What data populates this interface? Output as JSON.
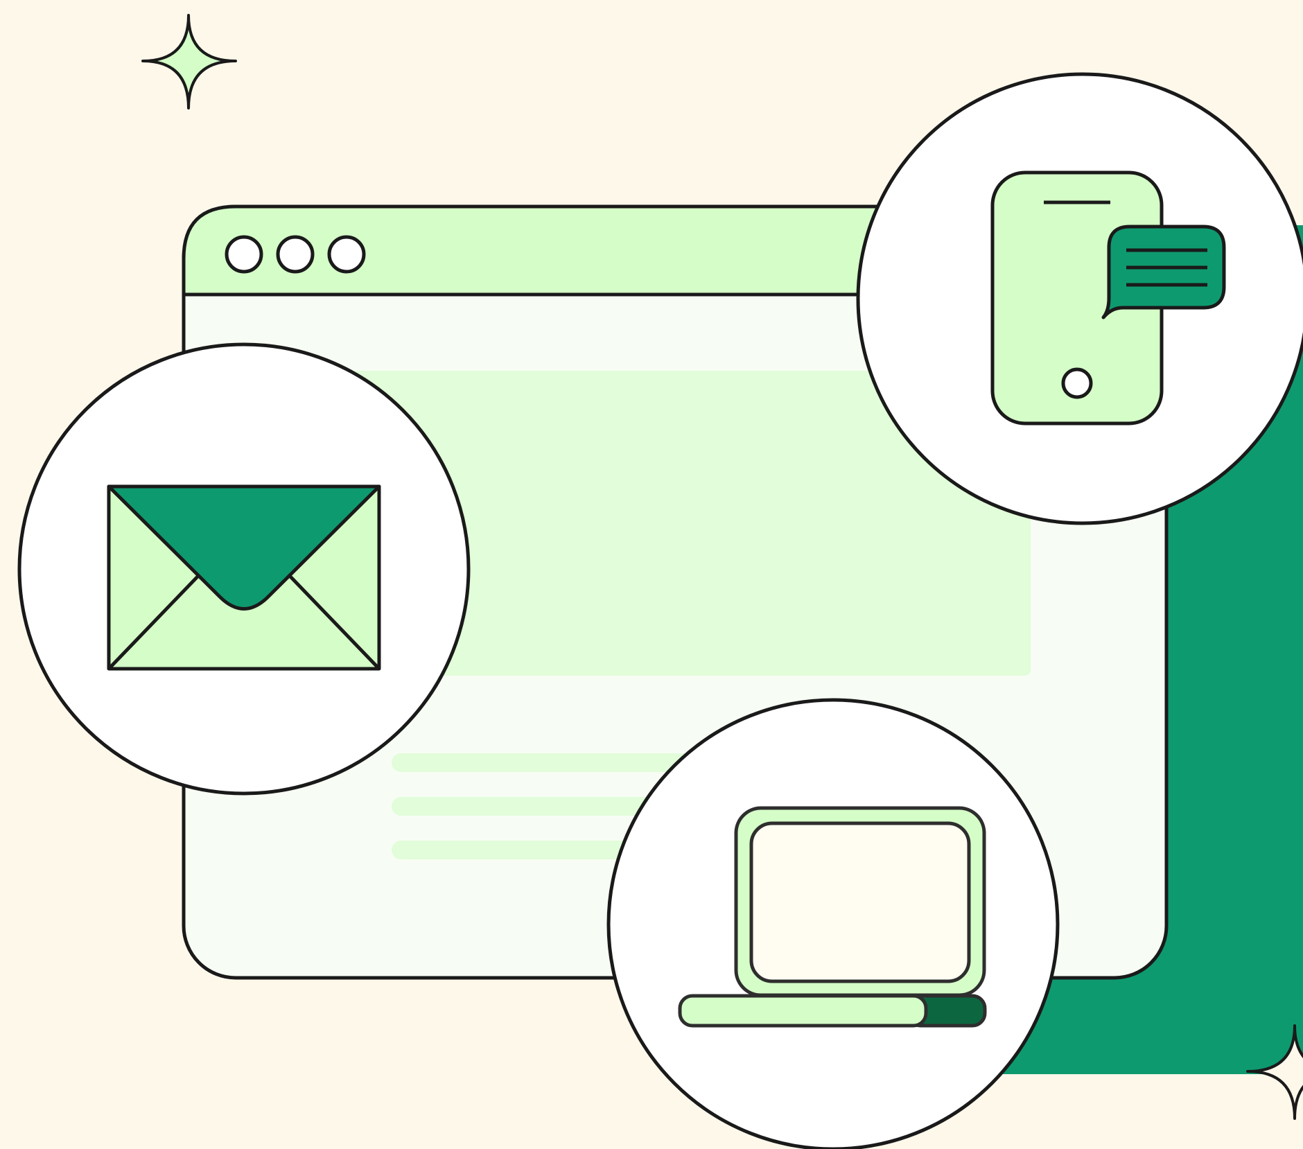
{
  "illustration": {
    "type": "multi-device-communication-illustration",
    "elements": [
      "sparkle-icon",
      "browser-window",
      "envelope-icon",
      "smartphone-icon",
      "chat-bubble-icon",
      "laptop-icon"
    ]
  },
  "browser_window": {
    "dot_count": 3
  },
  "colors": {
    "background": "#FEF8EB",
    "outline": "#1A1A1A",
    "light_green": "#D5FDC8",
    "pale_green": "#E2FDD9",
    "window_body": "#F7FDF4",
    "brand_green": "#0E9A6F",
    "dark_green": "#0C6740",
    "circle_fill": "#FFFFFF"
  }
}
